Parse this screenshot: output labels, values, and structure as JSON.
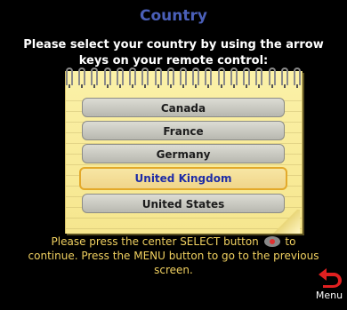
{
  "title": "Country",
  "instructions": "Please select your country by using the arrow keys on your remote control:",
  "countries": [
    {
      "label": "Canada",
      "selected": false
    },
    {
      "label": "France",
      "selected": false
    },
    {
      "label": "Germany",
      "selected": false
    },
    {
      "label": "United Kingdom",
      "selected": true
    },
    {
      "label": "United States",
      "selected": false
    }
  ],
  "footer": {
    "before_icon": "Please press the center SELECT button",
    "after_icon": "to continue.  Press the MENU button to go to the previous screen.",
    "select_icon": "select-button-icon"
  },
  "menu_button": {
    "label": "Menu",
    "icon": "back-arrow-icon",
    "color": "#e02020"
  },
  "colors": {
    "title": "#4a5fb8",
    "footer_text": "#f0d060",
    "selected_text": "#1f2da6",
    "highlight_border": "#e3a92a"
  }
}
